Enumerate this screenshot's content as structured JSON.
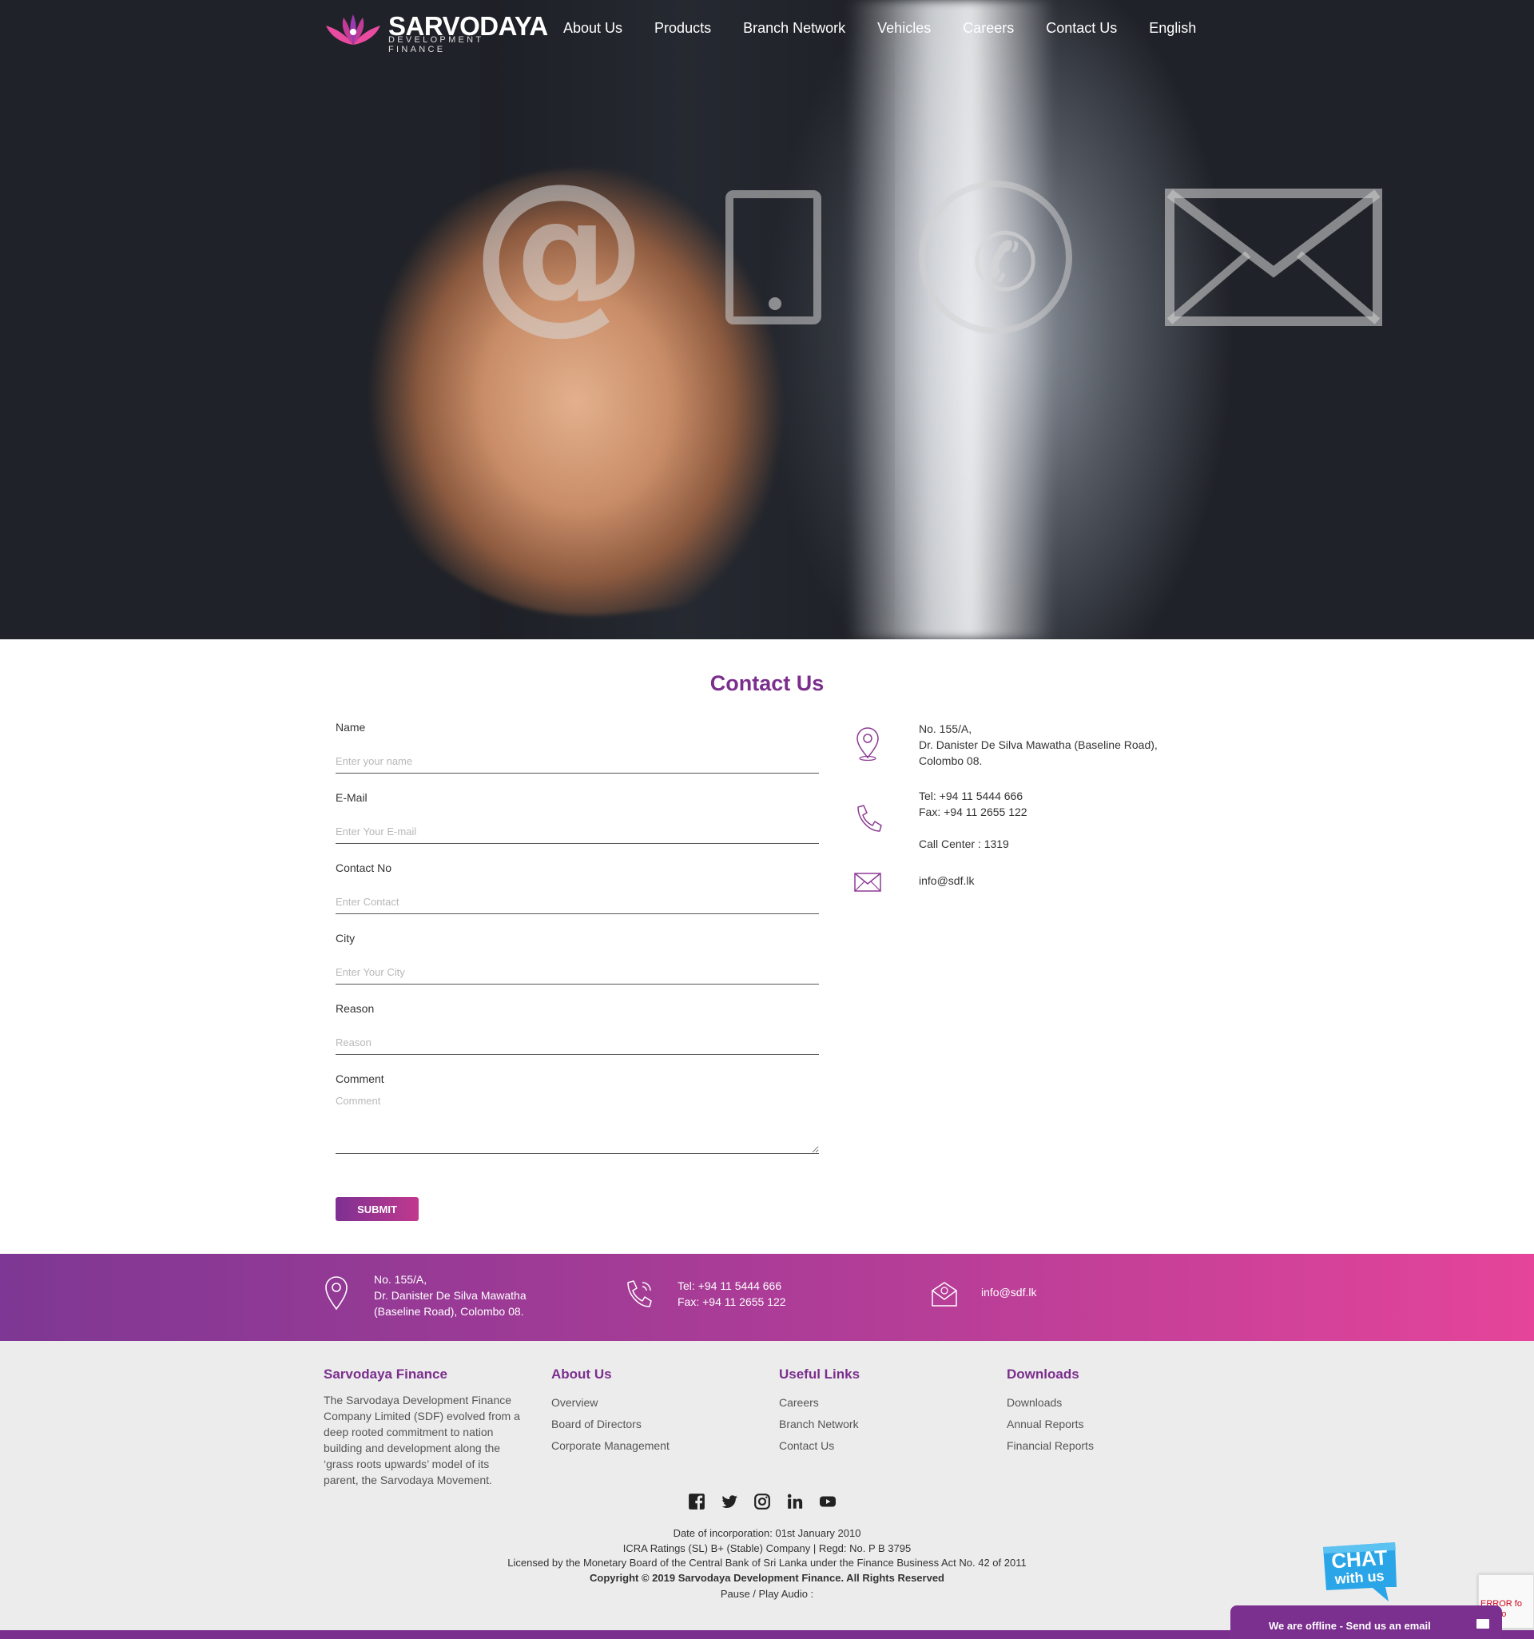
{
  "nav": {
    "logo": {
      "brand": "SARVODAYA",
      "sub": "DEVELOPMENT FINANCE"
    },
    "links": [
      "About Us",
      "Products",
      "Branch Network",
      "Vehicles",
      "Careers",
      "Contact Us",
      "English"
    ]
  },
  "contact": {
    "title": "Contact Us",
    "fields": [
      {
        "label": "Name",
        "placeholder": "Enter your name"
      },
      {
        "label": "E-Mail",
        "placeholder": "Enter Your E-mail"
      },
      {
        "label": "Contact No",
        "placeholder": "Enter Contact"
      },
      {
        "label": "City",
        "placeholder": "Enter Your City"
      },
      {
        "label": "Reason",
        "placeholder": "Reason"
      }
    ],
    "comment": {
      "label": "Comment",
      "placeholder": "Comment"
    },
    "submit_label": "SUBMIT",
    "info": {
      "address": [
        "No. 155/A,",
        "Dr. Danister De Silva Mawatha (Baseline Road),",
        "Colombo 08."
      ],
      "tel": "Tel: +94 11 5444 666",
      "fax": "Fax: +94 11 2655 122",
      "call_center": "Call Center : 1319",
      "email": "info@sdf.lk"
    }
  },
  "band": {
    "address": [
      "No. 155/A,",
      "Dr. Danister De Silva Mawatha",
      "(Baseline Road), Colombo 08."
    ],
    "tel": "Tel: +94 11 5444 666",
    "fax": "Fax: +94 11 2655 122",
    "email": "info@sdf.lk"
  },
  "footer": {
    "col1": {
      "title": "Sarvodaya Finance",
      "text": "The Sarvodaya Development Finance Company Limited (SDF) evolved from a deep rooted commitment to nation building and development along the ‘grass roots upwards’ model of its parent, the Sarvodaya Movement."
    },
    "col2": {
      "title": "About Us",
      "links": [
        "Overview",
        "Board of Directors",
        "Corporate Management"
      ]
    },
    "col3": {
      "title": "Useful Links",
      "links": [
        "Careers",
        "Branch Network",
        "Contact Us"
      ]
    },
    "col4": {
      "title": "Downloads",
      "links": [
        "Downloads",
        "Annual Reports",
        "Financial Reports"
      ]
    },
    "legal": {
      "incorporation": "Date of incorporation: 01st January 2010",
      "ratings": "ICRA Ratings (SL) B+ (Stable) Company | Regd: No. P B 3795",
      "license": "Licensed by the Monetary Board of the Central Bank of Sri Lanka under the Finance Business Act No. 42 of 2011",
      "copyright": "Copyright © 2019 Sarvodaya Development Finance. All Rights Reserved",
      "audio": "Pause / Play Audio :"
    }
  },
  "chat": {
    "badge_line1": "CHAT",
    "badge_line2": "with us",
    "offline": "We are offline - Send us an email"
  },
  "recaptcha": {
    "error_line1": "ERROR fo",
    "error_line2": "alid do"
  },
  "colors": {
    "brand_purple": "#7b2f8d",
    "band_start": "#7e3794",
    "band_end": "#e5449a",
    "footer_bg": "#ececec"
  }
}
